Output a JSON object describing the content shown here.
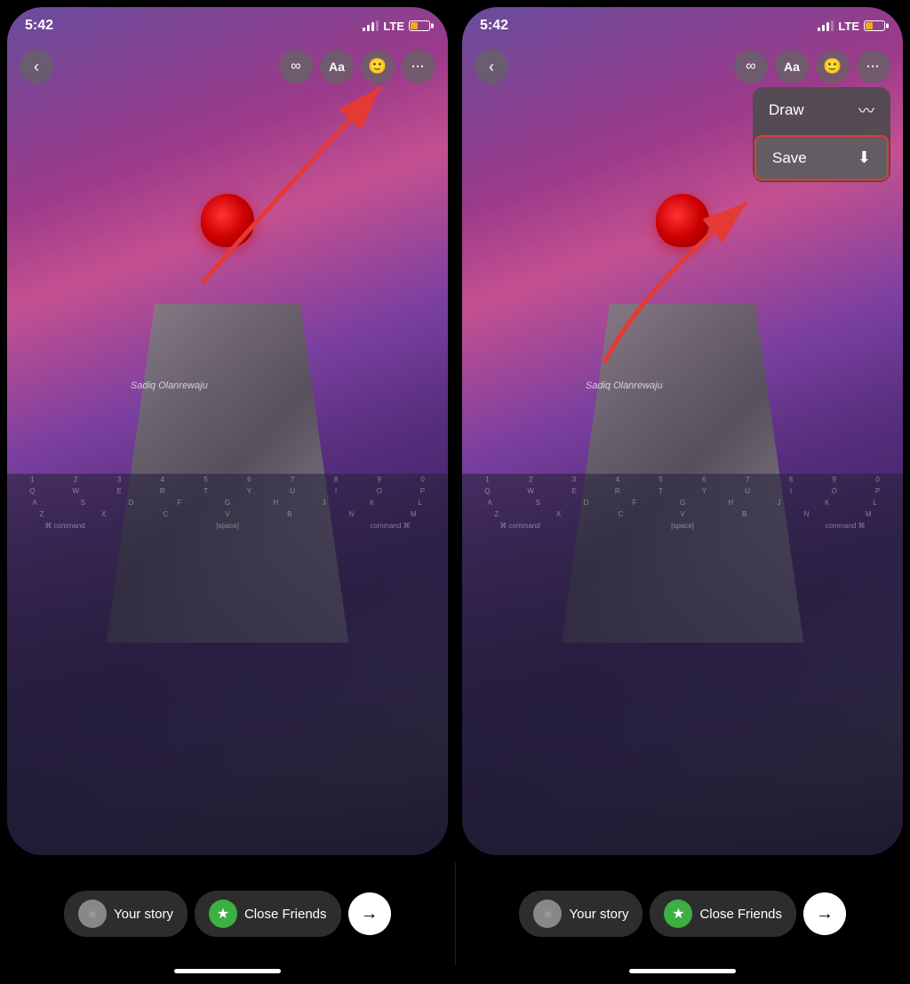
{
  "left_screen": {
    "time": "5:42",
    "signal": "LTE",
    "toolbar": {
      "back_label": "‹",
      "infinity_label": "∞",
      "text_label": "Aa",
      "sticker_label": "☺",
      "more_label": "•••"
    },
    "watermark": "Sadiq Olanrewaju",
    "bottom": {
      "your_story_label": "Your story",
      "close_friends_label": "Close Friends",
      "send_label": "→"
    }
  },
  "right_screen": {
    "time": "5:42",
    "signal": "LTE",
    "toolbar": {
      "back_label": "‹",
      "infinity_label": "∞",
      "text_label": "Aa",
      "sticker_label": "☺",
      "more_label": "•••"
    },
    "watermark": "Sadiq Olanrewaju",
    "menu": {
      "draw_label": "Draw",
      "draw_icon": "〰",
      "save_label": "Save",
      "save_icon": "⬇"
    },
    "bottom": {
      "your_story_label": "Your story",
      "close_friends_label": "Close Friends",
      "send_label": "→"
    }
  },
  "colors": {
    "accent_red": "#e53935",
    "green": "#3cb043",
    "toolbar_bg": "rgba(100,100,100,0.75)",
    "menu_bg": "rgba(80,75,80,0.95)"
  }
}
